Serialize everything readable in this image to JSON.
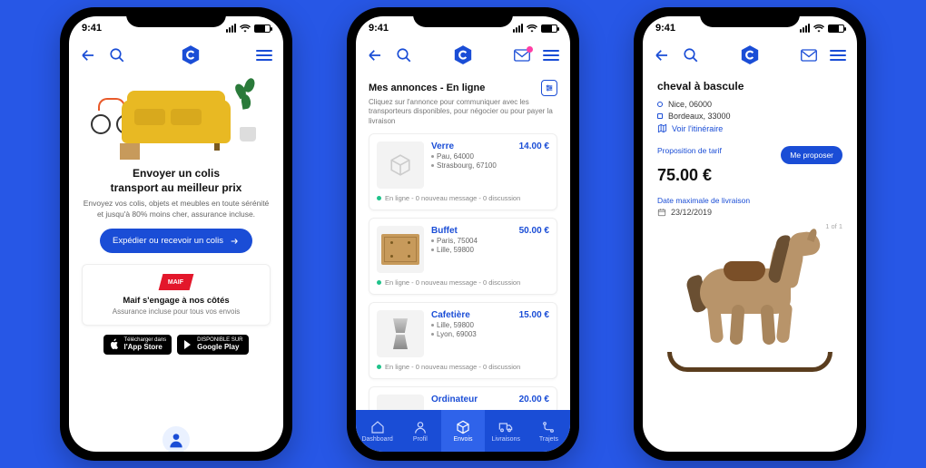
{
  "statusbar": {
    "time": "9:41"
  },
  "phone1": {
    "headline_l1": "Envoyer un colis",
    "headline_l2": "transport au meilleur prix",
    "sub": "Envoyez vos colis, objets et meubles en toute sérénité et jusqu'à 80% moins cher, assurance incluse.",
    "cta": "Expédier ou recevoir un colis",
    "maif_logo": "MAIF",
    "maif_title": "Maif s'engage à nos côtés",
    "maif_sub": "Assurance incluse pour tous vos envois",
    "appstore_top": "Télécharger dans",
    "appstore_bottom": "l'App Store",
    "play_top": "DISPONIBLE SUR",
    "play_bottom": "Google Play"
  },
  "phone2": {
    "section_title": "Mes annonces - En ligne",
    "help": "Cliquez sur l'annonce pour communiquer avec les transporteurs disponibles, pour négocier ou pour payer la livraison",
    "items": [
      {
        "title": "Verre",
        "price": "14.00 €",
        "from": "Pau, 64000",
        "to": "Strasbourg, 67100",
        "status": "En ligne - 0 nouveau message - 0 discussion"
      },
      {
        "title": "Buffet",
        "price": "50.00 €",
        "from": "Paris, 75004",
        "to": "Lille, 59800",
        "status": "En ligne - 0 nouveau message - 0 discussion"
      },
      {
        "title": "Cafetière",
        "price": "15.00 €",
        "from": "Lille, 59800",
        "to": "Lyon, 69003",
        "status": "En ligne - 0 nouveau message - 0 discussion"
      },
      {
        "title": "Ordinateur",
        "price": "20.00 €",
        "from": "",
        "to": "",
        "status": ""
      }
    ],
    "tabs": [
      "Dashboard",
      "Profil",
      "Envois",
      "Livraisons",
      "Trajets"
    ]
  },
  "phone3": {
    "title": "cheval à bascule",
    "from": "Nice, 06000",
    "to": "Bordeaux, 33000",
    "itin": "Voir l'itinéraire",
    "prop_label": "Proposition de tarif",
    "prop_btn": "Me proposer",
    "price": "75.00 €",
    "deadline_label": "Date maximale de livraison",
    "deadline": "23/12/2019",
    "pager": "1 of 1"
  }
}
